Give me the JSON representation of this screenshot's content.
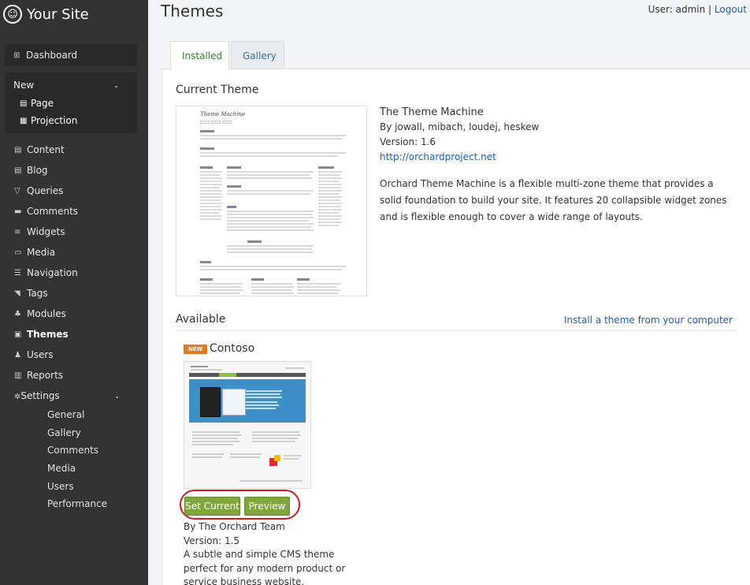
{
  "brand": {
    "site_name": "Your Site"
  },
  "header": {
    "title": "Themes",
    "user_label": "User: admin",
    "separator": "|",
    "logout": "Logout"
  },
  "sidebar": {
    "dashboard": "Dashboard",
    "new_section": {
      "label": "New",
      "items": [
        "Page",
        "Projection"
      ]
    },
    "menu": [
      "Content",
      "Blog",
      "Queries",
      "Comments",
      "Widgets",
      "Media",
      "Navigation",
      "Tags",
      "Modules",
      "Themes",
      "Users",
      "Reports"
    ],
    "active": "Themes",
    "settings": {
      "label": "Settings",
      "items": [
        "General",
        "Gallery",
        "Comments",
        "Media",
        "Users",
        "Performance"
      ]
    }
  },
  "tabs": [
    {
      "label": "Installed",
      "active": true
    },
    {
      "label": "Gallery",
      "active": false
    }
  ],
  "current_theme": {
    "section_title": "Current Theme",
    "name": "The Theme Machine",
    "authors": "By jowall, mibach, loudej, heskew",
    "version": "Version: 1.6",
    "url": "http://orchardproject.net",
    "description": "Orchard Theme Machine is a flexible multi-zone theme that provides a solid foundation to build your site. It features 20 collapsible widget zones and is flexible enough to cover a wide range of layouts.",
    "thumbnail_title": "Theme Machine"
  },
  "available": {
    "section_title": "Available",
    "install_link": "Install a theme from your computer",
    "themes": [
      {
        "badge": "NEW",
        "name": "Contoso",
        "set_current_label": "Set Current",
        "preview_label": "Preview",
        "author": "By The Orchard Team",
        "version": "Version: 1.5",
        "description": "A subtle and simple CMS theme perfect for any modern product or service business website."
      }
    ]
  },
  "colors": {
    "sidebar_bg": "#333333",
    "accent_green": "#7fa63f",
    "link_blue": "#1e5ebf",
    "badge_orange": "#e5791e",
    "highlight_ring": "#cc1b1b"
  }
}
